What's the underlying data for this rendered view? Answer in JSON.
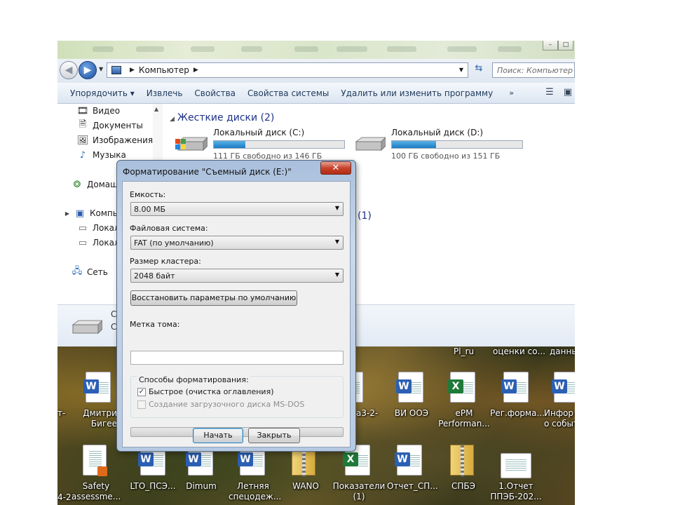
{
  "explorer": {
    "address": {
      "crumb": "Компьютер",
      "search_placeholder": "Поиск: Компьютер"
    },
    "toolbar": {
      "items": [
        "Упорядочить ▾",
        "Извлечь",
        "Свойства",
        "Свойства системы",
        "Удалить или изменить программу",
        "»"
      ]
    },
    "nav": {
      "items": [
        "Видео",
        "Документы",
        "Изображения",
        "Музыка",
        "Домаш",
        "Компь",
        "Локал",
        "Локал",
        "Сеть"
      ]
    },
    "content": {
      "hdd_header": "Жесткие диски (2)",
      "removable_count": "(1)",
      "drives": [
        {
          "name": "Локальный диск (C:)",
          "free": "111 ГБ свободно из 146 ГБ",
          "used_fraction": 0.24
        },
        {
          "name": "Локальный диск (D:)",
          "free": "100 ГБ свободно из 151 ГБ",
          "used_fraction": 0.34
        }
      ]
    },
    "details": {
      "letter": "С",
      "letter2": "С"
    }
  },
  "desktop": {
    "top_labels": [
      "Pl_ru",
      "оценки со...",
      "данны"
    ],
    "icons_row1": [
      {
        "label1": "Дмитри;р і",
        "label2": "Бигеев",
        "kind": "word"
      },
      {
        "label1": "а3-2-",
        "label2": "",
        "kind": "word"
      },
      {
        "label1": "ВИ ООЭ",
        "label2": "",
        "kind": "word"
      },
      {
        "label1": "ePM",
        "label2": "Performan...",
        "kind": "excel"
      },
      {
        "label1": "Рег.форма...",
        "label2": "",
        "kind": "word"
      },
      {
        "label1": "Инфор",
        "label2": "о событ",
        "kind": "word"
      }
    ],
    "icons_row2": [
      {
        "label1": "4-2",
        "label2": ""
      },
      {
        "label1": "Safety",
        "label2": "assessme..."
      },
      {
        "label1": "LTO_ПСЭ...",
        "label2": ""
      },
      {
        "label1": "Dimum",
        "label2": ""
      },
      {
        "label1": "Летняя",
        "label2": "спецодеж..."
      },
      {
        "label1": "WANO",
        "label2": ""
      },
      {
        "label1": "Показатели",
        "label2": "(1)"
      },
      {
        "label1": "Отчет_СП...",
        "label2": ""
      },
      {
        "label1": "СПБЭ",
        "label2": ""
      },
      {
        "label1": "1.Отчет",
        "label2": "ППЭБ-202..."
      }
    ],
    "edge_labels": [
      "т-",
      "т-"
    ]
  },
  "dialog": {
    "title": "Форматирование \"Съемный диск (E:)\"",
    "close": "✕",
    "capacity_label": "Емкость:",
    "capacity_value": "8.00 МБ",
    "fs_label": "Файловая система:",
    "fs_value": "FAT (по умолчанию)",
    "cluster_label": "Размер кластера:",
    "cluster_value": "2048 байт",
    "restore_button": "Восстановить параметры по умолчанию",
    "volume_label": "Метка тома:",
    "volume_value": "",
    "format_options_title": "Способы форматирования:",
    "quick_label": "Быстрое (очистка оглавления)",
    "quick_checked": true,
    "msdos_label": "Создание загрузочного диска MS-DOS",
    "msdos_checked": false,
    "progress": 0,
    "start_button": "Начать",
    "close_button": "Закрыть"
  },
  "colors": {
    "accent": "#1e3287",
    "close_red": "#c6442c",
    "progress_green": "#37b52b"
  }
}
